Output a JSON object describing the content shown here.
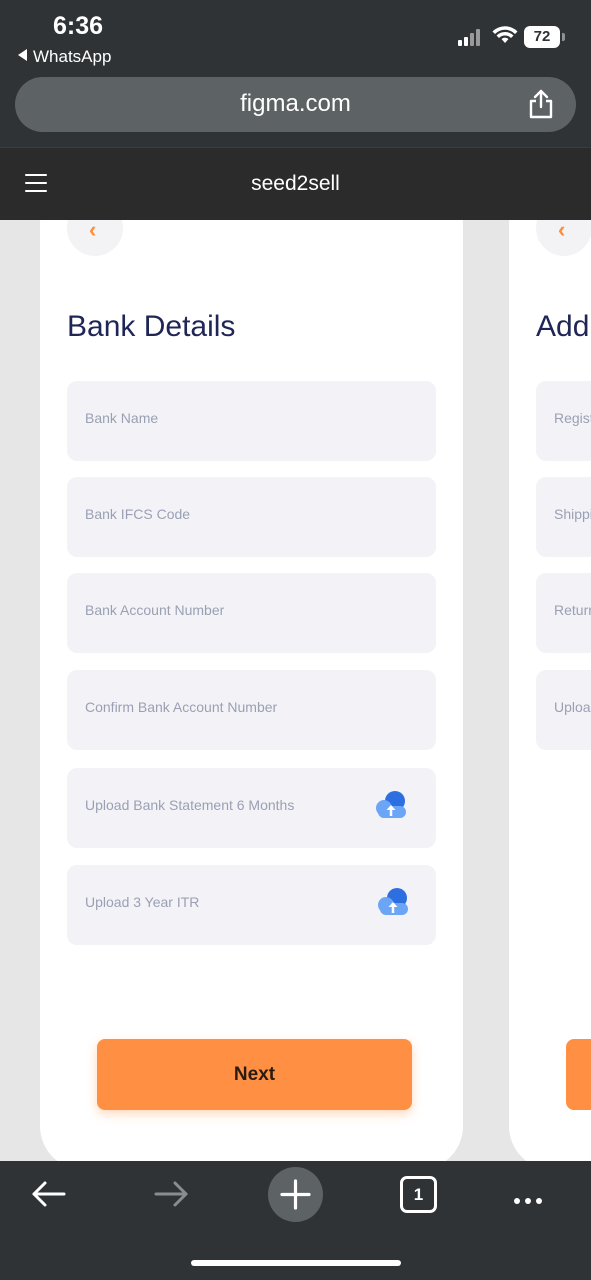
{
  "status": {
    "time": "6:36",
    "back_app": "WhatsApp",
    "battery": "72"
  },
  "browser": {
    "url": "figma.com",
    "tabs_count": "1"
  },
  "app": {
    "title": "seed2sell"
  },
  "screen1": {
    "title": "Bank Details",
    "fields": [
      {
        "label": "Bank Name"
      },
      {
        "label": "Bank IFCS Code"
      },
      {
        "label": "Bank Account Number"
      },
      {
        "label": "Confirm Bank Account Number"
      },
      {
        "label": "Upload Bank Statement 6 Months",
        "icon": "cloud-upload-icon"
      },
      {
        "label": "Upload 3 Year ITR",
        "icon": "cloud-upload-icon"
      }
    ],
    "next_label": "Next"
  },
  "screen2": {
    "title": "Add",
    "fields": [
      {
        "label": "Regist"
      },
      {
        "label": "Shippi"
      },
      {
        "label": "Returr"
      },
      {
        "label": "Uploa"
      }
    ]
  },
  "colors": {
    "accent": "#ff9043",
    "title": "#1f2656",
    "field_bg": "#f3f3f7",
    "placeholder": "#9aa0b4"
  }
}
